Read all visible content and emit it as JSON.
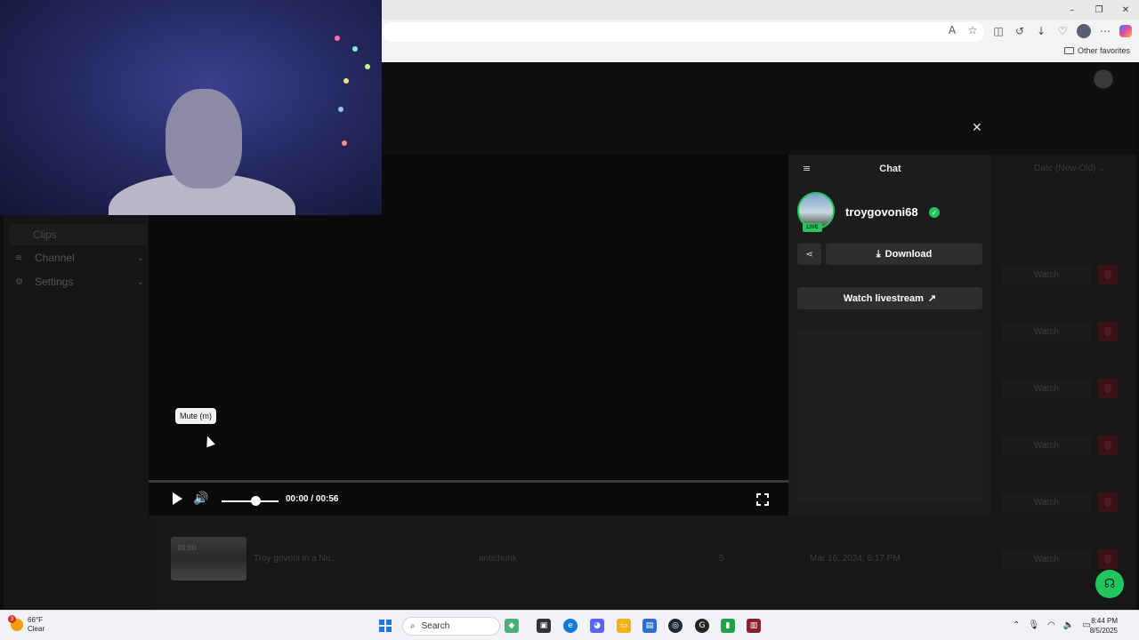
{
  "browser": {
    "favorites_label": "Other favorites",
    "window_controls": [
      "minimize",
      "restore",
      "close"
    ]
  },
  "sidebar": {
    "items": [
      {
        "label": "Clips",
        "icon": "clips-icon"
      },
      {
        "label": "Channel",
        "icon": "channel-icon"
      },
      {
        "label": "Settings",
        "icon": "gear-icon"
      }
    ]
  },
  "list": {
    "sort_label": "Date (New-Old)",
    "watch_label": "Watch",
    "rows": [
      {
        "duration": "01:00",
        "title": "Troy govoni in a Nu...",
        "creator": "antichunk",
        "views": "5",
        "date": "Mar 16, 2024, 6:17 PM"
      }
    ]
  },
  "player": {
    "tooltip": "Mute (m)",
    "time": "00:00 / 00:56",
    "volume": 0.62,
    "progress": 0
  },
  "chat": {
    "title": "Chat",
    "username": "troygovoni68",
    "live_badge": "LIVE",
    "download_label": "Download",
    "watch_livestream_label": "Watch livestream"
  },
  "taskbar": {
    "weather_temp": "66°F",
    "weather_desc": "Clear",
    "weather_badge": "3",
    "search_placeholder": "Search",
    "time": "8:44 PM",
    "date": "8/5/2025"
  },
  "colors": {
    "accent_green": "#22c55e",
    "delete_red": "#3b1218",
    "panel": "#1c1c1c"
  }
}
